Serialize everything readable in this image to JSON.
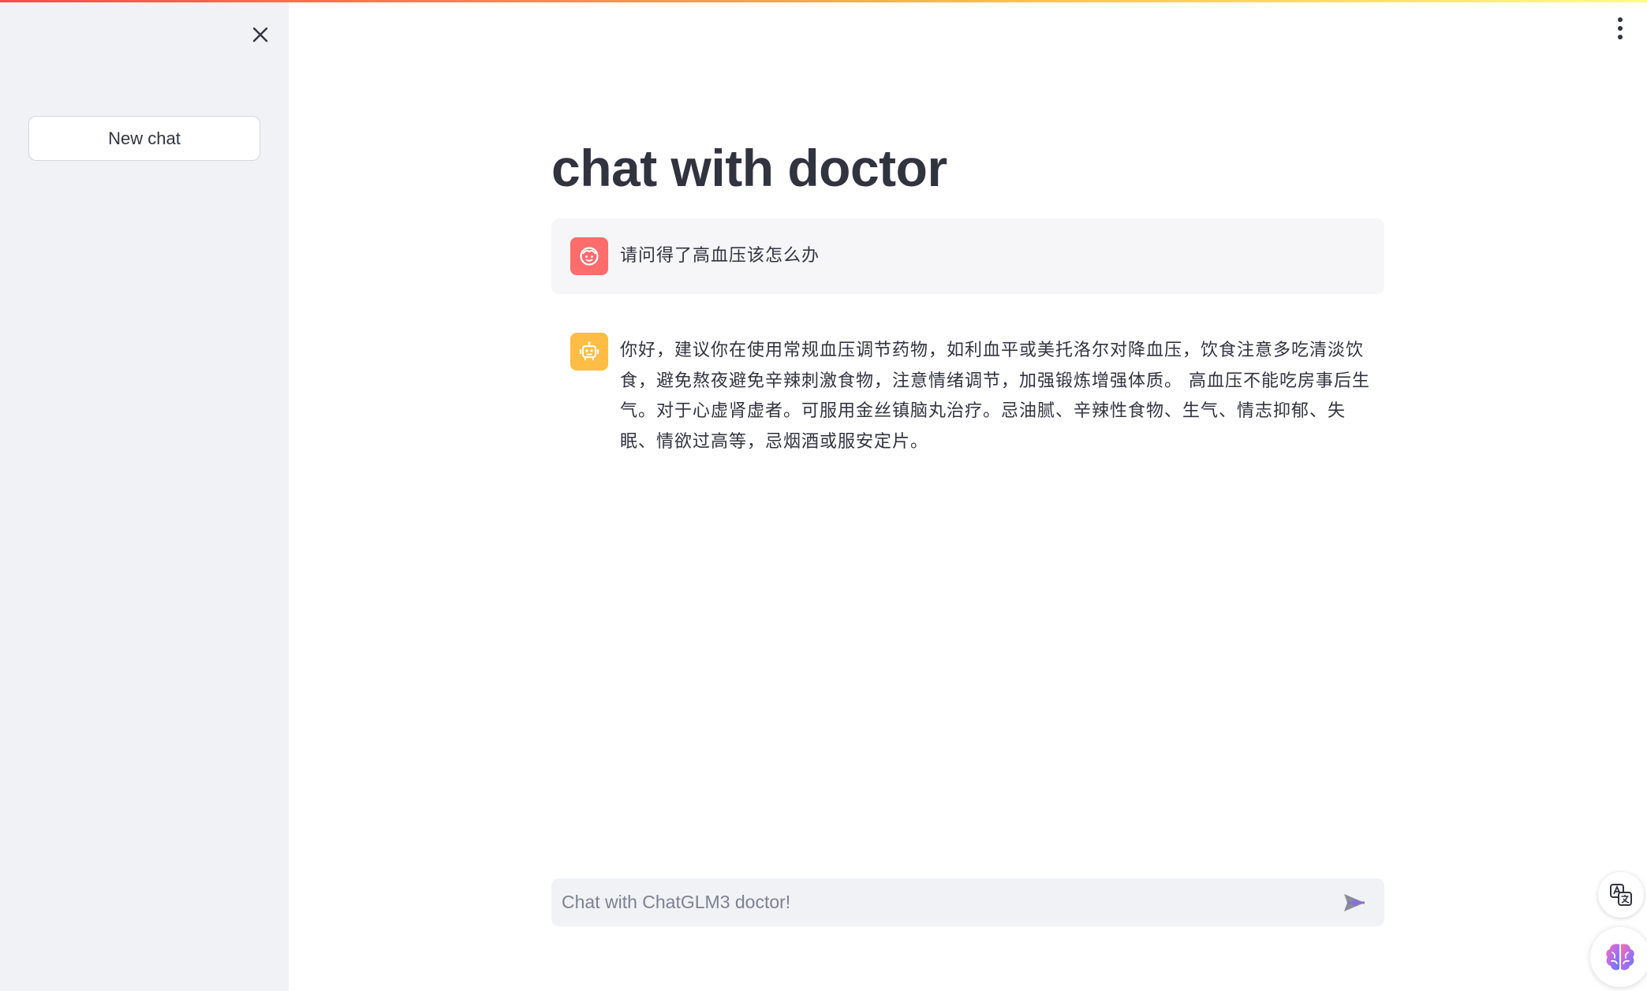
{
  "sidebar": {
    "new_chat_label": "New chat"
  },
  "main": {
    "title": "chat with doctor",
    "messages": [
      {
        "role": "user",
        "text": "请问得了高血压该怎么办"
      },
      {
        "role": "assistant",
        "text": "你好，建议你在使用常规血压调节药物，如利血平或美托洛尔对降血压，饮食注意多吃清淡饮食，避免熬夜避免辛辣刺激食物，注意情绪调节，加强锻炼增强体质。 高血压不能吃房事后生气。对于心虚肾虚者。可服用金丝镇脑丸治疗。忌油腻、辛辣性食物、生气、情志抑郁、失眠、情欲过高等，忌烟酒或服安定片。"
      }
    ],
    "chat_input": {
      "placeholder": "Chat with ChatGLM3 doctor!",
      "value": ""
    }
  },
  "icons": {
    "close": "close-icon",
    "menu": "kebab-menu-icon",
    "user_avatar": "user-face-icon",
    "assistant_avatar": "robot-icon",
    "send": "send-icon",
    "translate": "translate-icon",
    "brain": "brain-icon"
  },
  "colors": {
    "sidebar_bg": "#f0f2f6",
    "user_avatar": "#ff6c6c",
    "assistant_avatar": "#ffbd45",
    "text": "#31333f",
    "send_accent": "#8b6fd6"
  }
}
